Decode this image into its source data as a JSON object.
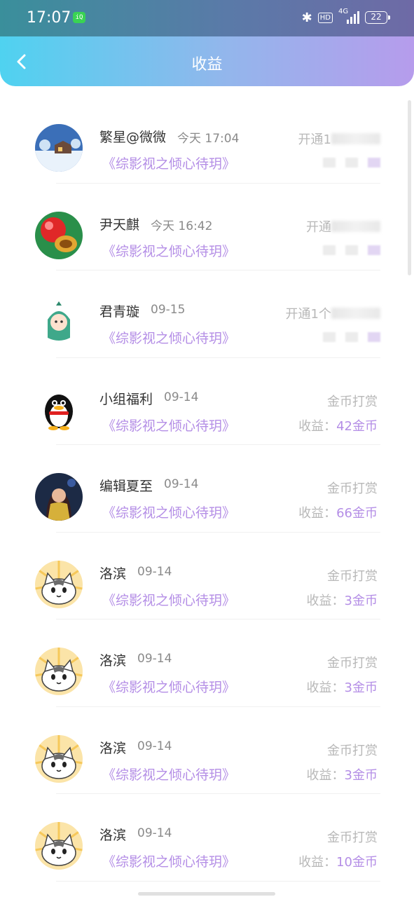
{
  "status_bar": {
    "time": "17:07",
    "battery": "22",
    "network": "4G",
    "hd": "HD"
  },
  "header": {
    "title": "收益"
  },
  "items": [
    {
      "name": "繁星@微微",
      "time": "今天 17:04",
      "book": "《综影视之倾心待玥》",
      "type": "开通1",
      "income": "",
      "blurred": true,
      "avatar": "winter-cabin"
    },
    {
      "name": "尹天麒",
      "time": "今天 16:42",
      "book": "《综影视之倾心待玥》",
      "type": "开通",
      "income": "",
      "blurred": true,
      "avatar": "game-ball"
    },
    {
      "name": "君青璇",
      "time": "09-15",
      "book": "《综影视之倾心待玥》",
      "type": "开通1个",
      "income": "",
      "blurred": true,
      "avatar": "anime-dino"
    },
    {
      "name": "小组福利",
      "time": "09-14",
      "book": "《综影视之倾心待玥》",
      "type": "金币打赏",
      "income_label": "收益：",
      "income": "42金币",
      "blurred": false,
      "avatar": "penguin"
    },
    {
      "name": "编辑夏至",
      "time": "09-14",
      "book": "《综影视之倾心待玥》",
      "type": "金币打赏",
      "income_label": "收益：",
      "income": "66金币",
      "blurred": false,
      "avatar": "portrait"
    },
    {
      "name": "洛滨",
      "time": "09-14",
      "book": "《综影视之倾心待玥》",
      "type": "金币打赏",
      "income_label": "收益：",
      "income": "3金币",
      "blurred": false,
      "avatar": "cat"
    },
    {
      "name": "洛滨",
      "time": "09-14",
      "book": "《综影视之倾心待玥》",
      "type": "金币打赏",
      "income_label": "收益：",
      "income": "3金币",
      "blurred": false,
      "avatar": "cat"
    },
    {
      "name": "洛滨",
      "time": "09-14",
      "book": "《综影视之倾心待玥》",
      "type": "金币打赏",
      "income_label": "收益：",
      "income": "3金币",
      "blurred": false,
      "avatar": "cat"
    },
    {
      "name": "洛滨",
      "time": "09-14",
      "book": "《综影视之倾心待玥》",
      "type": "金币打赏",
      "income_label": "收益：",
      "income": "10金币",
      "blurred": false,
      "avatar": "cat"
    }
  ]
}
